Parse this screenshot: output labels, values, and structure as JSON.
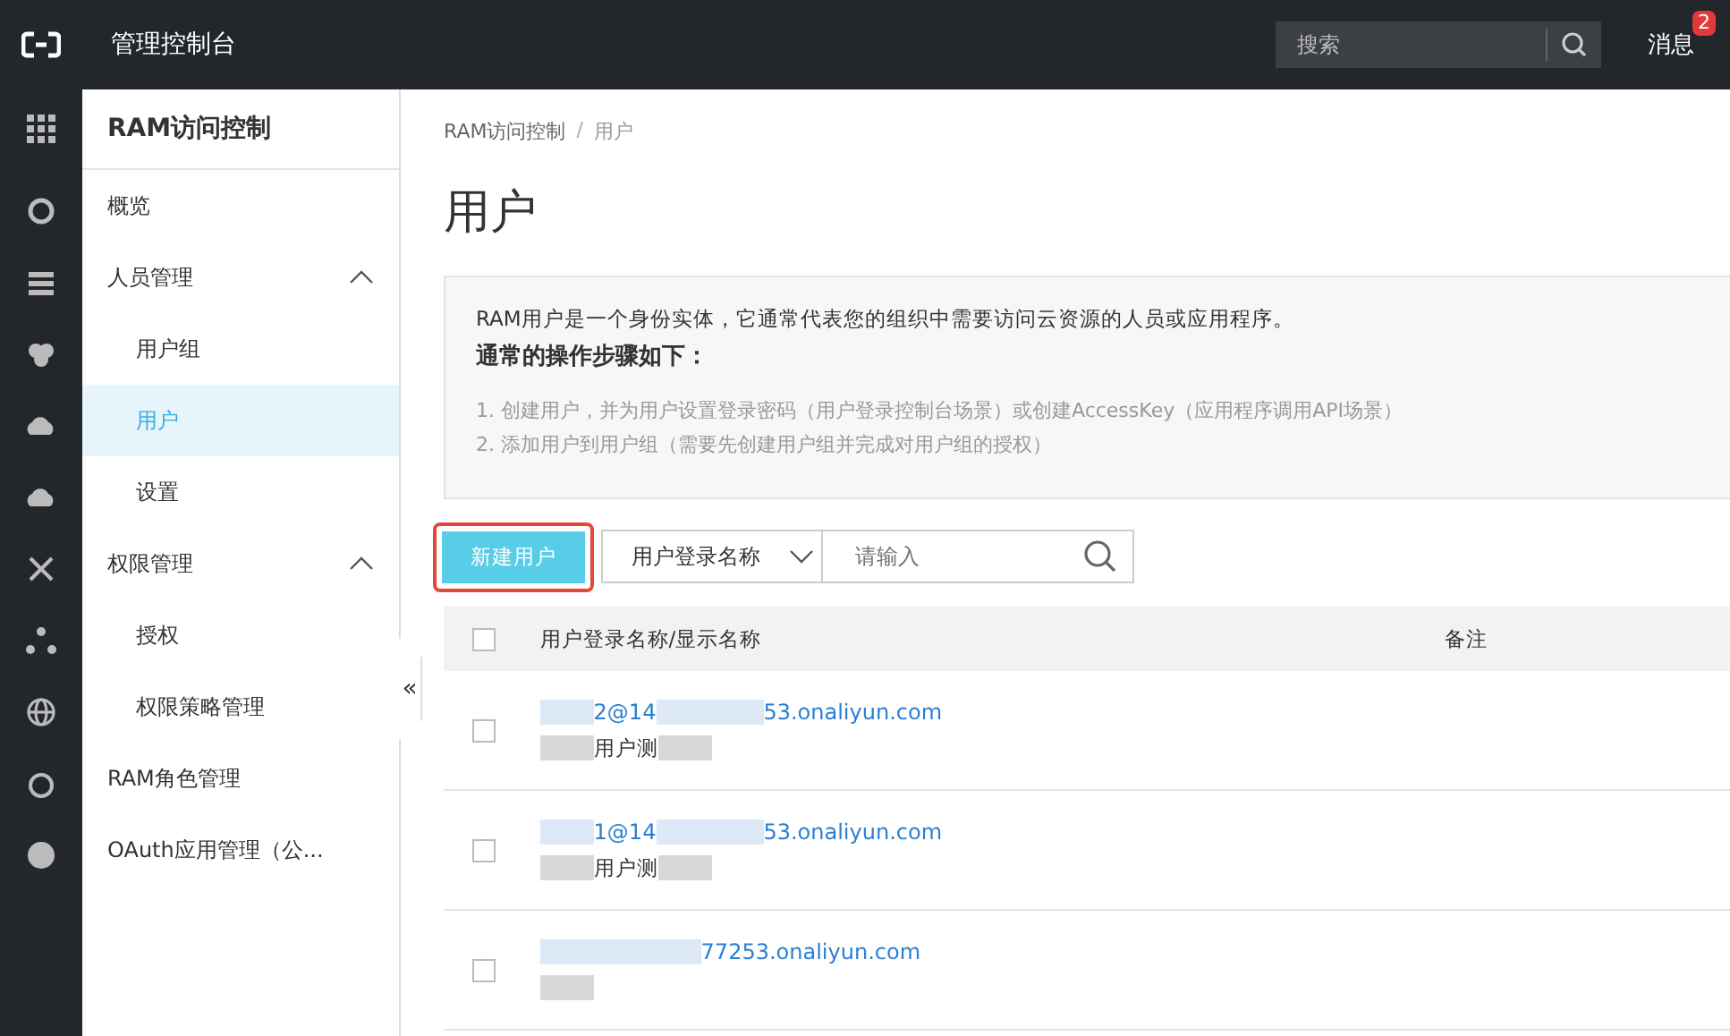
{
  "topbar": {
    "title": "管理控制台",
    "search": {
      "placeholder": "搜索"
    },
    "messages": {
      "label": "消息",
      "badge": "2"
    }
  },
  "sidebar": {
    "title": "RAM访问控制",
    "items": [
      {
        "label": "概览",
        "selected": false
      },
      {
        "label": "人员管理",
        "selected": false,
        "expanded": true,
        "children": [
          {
            "label": "用户组",
            "selected": false
          },
          {
            "label": "用户",
            "selected": true
          },
          {
            "label": "设置",
            "selected": false
          }
        ]
      },
      {
        "label": "权限管理",
        "selected": false,
        "expanded": true,
        "children": [
          {
            "label": "授权",
            "selected": false
          },
          {
            "label": "权限策略管理",
            "selected": false
          }
        ]
      },
      {
        "label": "RAM角色管理",
        "selected": false
      },
      {
        "label": "OAuth应用管理（公...",
        "selected": false
      }
    ]
  },
  "sidebar_toggle": "«",
  "breadcrumb": [
    "RAM访问控制",
    "用户"
  ],
  "breadcrumb_separator": "/",
  "page_title": "用户",
  "info": {
    "description": "RAM用户是一个身份实体，它通常代表您的组织中需要访问云资源的人员或应用程序。",
    "heading": "通常的操作步骤如下：",
    "steps": [
      "1. 创建用户，并为用户设置登录密码（用户登录控制台场景）或创建AccessKey（应用程序调用API场景）",
      "2. 添加用户到用户组（需要先创建用户组并完成对用户组的授权）"
    ]
  },
  "toolbar": {
    "create_button": {
      "label": "新建用户",
      "highlighted": true
    },
    "filter_select": "用户登录名称",
    "search": {
      "placeholder": "请输入"
    }
  },
  "table": {
    "columns": [
      "用户登录名称/显示名称",
      "备注"
    ],
    "all_checked": false,
    "rows": [
      {
        "checked": false,
        "login_head": "2@14",
        "login_tail": "53.onaliyun.com",
        "display": "用户测"
      },
      {
        "checked": false,
        "login_head": "1@14",
        "login_tail": "53.onaliyun.com",
        "display": "用户测"
      },
      {
        "checked": false,
        "login_tail": "77253.onaliyun.com"
      }
    ]
  }
}
